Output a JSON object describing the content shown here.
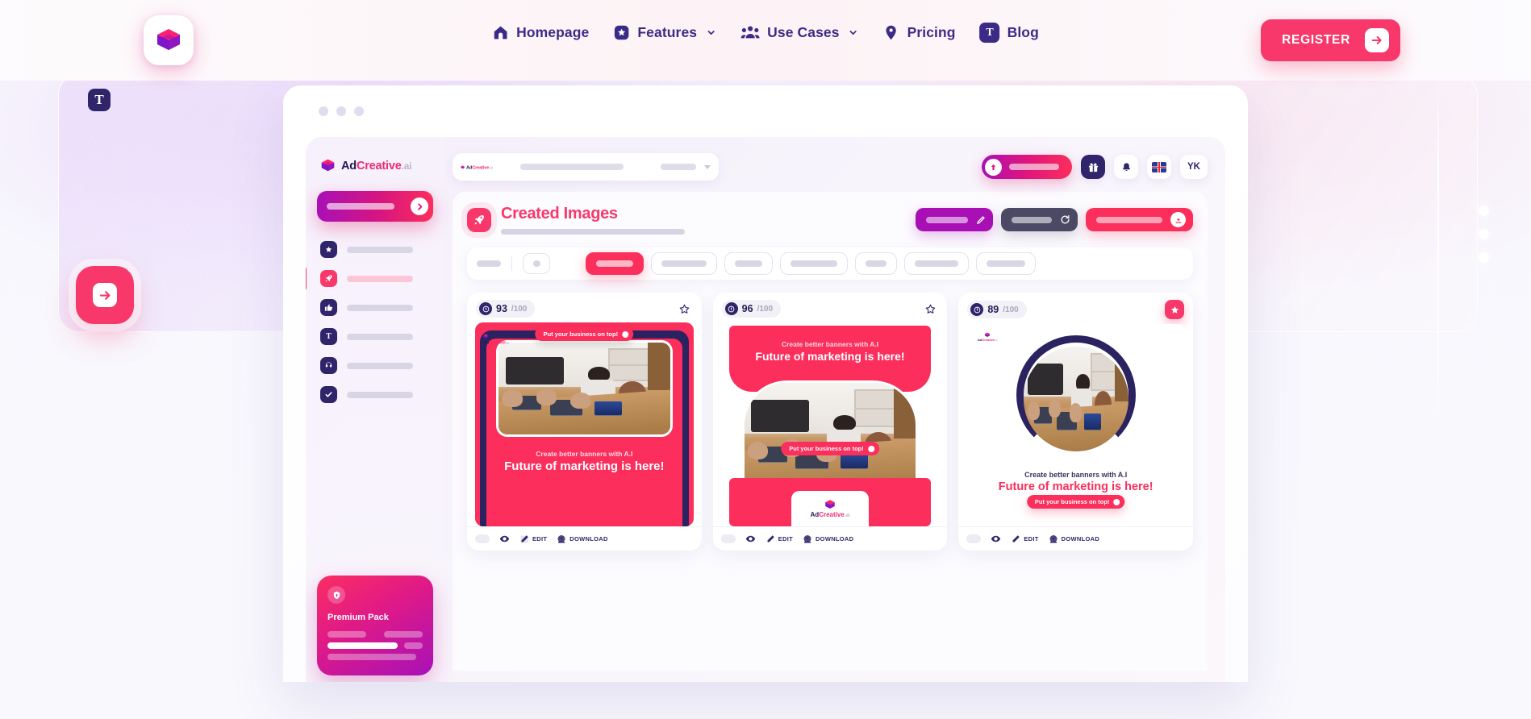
{
  "nav": {
    "logo_name": "adcreative-layers-logo",
    "items": [
      {
        "label": "Homepage",
        "icon": "home-icon",
        "caret": false
      },
      {
        "label": "Features",
        "icon": "star-badge-icon",
        "caret": true
      },
      {
        "label": "Use Cases",
        "icon": "people-icon",
        "caret": true
      },
      {
        "label": "Pricing",
        "icon": "tag-pin-icon",
        "caret": false
      },
      {
        "label": "Blog",
        "icon": "text-t-icon",
        "caret": false
      }
    ],
    "register_label": "REGISTER",
    "register_icon": "arrow-right-icon"
  },
  "hero": {
    "float_t_label": "T",
    "float_arrow_icon": "arrow-right-icon",
    "dots_count": 3
  },
  "app": {
    "brand": {
      "ad": "Ad",
      "creative": "Creative",
      "ai": ".ai"
    },
    "sidebar": {
      "cta_icon": "chevron-right-icon",
      "items": [
        {
          "icon": "star-icon",
          "active": false
        },
        {
          "icon": "rocket-icon",
          "active": true
        },
        {
          "icon": "thumbs-up-icon",
          "active": false
        },
        {
          "icon": "text-t-icon",
          "active": false
        },
        {
          "icon": "headset-icon",
          "active": false
        },
        {
          "icon": "check-icon",
          "active": false
        }
      ],
      "premium": {
        "title": "Premium Pack",
        "badge_icon": "shield-up-icon"
      }
    },
    "topbar": {
      "search_placeholder": "",
      "credit_icon": "arrow-up-circle-icon",
      "gift_icon": "gift-icon",
      "bell_icon": "bell-icon",
      "flag_icon": "uk-flag-icon",
      "avatar_initials": "YK"
    },
    "panel": {
      "title": "Created Images",
      "title_icon": "rocket-icon",
      "actions": [
        {
          "name": "edit-action",
          "icon": "pencil-icon",
          "color": "#a80fb4"
        },
        {
          "name": "refresh-action",
          "icon": "refresh-icon",
          "color": "#4c4965"
        },
        {
          "name": "download-action",
          "icon": "download-icon",
          "color": "#fb2e5c"
        }
      ],
      "filters": {
        "pill_count": 7,
        "active_index": 0
      }
    },
    "cards": [
      {
        "score": "93",
        "score_denom": "/100",
        "favorited": false,
        "layout": "photo-top",
        "pill_text": "Put your business on top!",
        "subheadline": "Create better banners with A.I",
        "headline": "Future of marketing is here!",
        "footer": {
          "edit": "EDIT",
          "download": "DOWNLOAD"
        }
      },
      {
        "score": "96",
        "score_denom": "/100",
        "favorited": false,
        "layout": "text-top",
        "pill_text": "Put your business on top!",
        "subheadline": "Create better banners with A.I",
        "headline": "Future of marketing is here!",
        "footer": {
          "edit": "EDIT",
          "download": "DOWNLOAD"
        }
      },
      {
        "score": "89",
        "score_denom": "/100",
        "favorited": true,
        "layout": "circle-arc",
        "pill_text": "Put your business on top!",
        "subheadline": "Create better banners with A.I",
        "headline": "Future of marketing is here!",
        "footer": {
          "edit": "EDIT",
          "download": "DOWNLOAD"
        }
      }
    ]
  },
  "colors": {
    "pink": "#f8386a",
    "hot_pink": "#fb2e5c",
    "magenta": "#ee2a73",
    "purple": "#a80fb4",
    "navy": "#30246b",
    "slate": "#4c4965"
  }
}
